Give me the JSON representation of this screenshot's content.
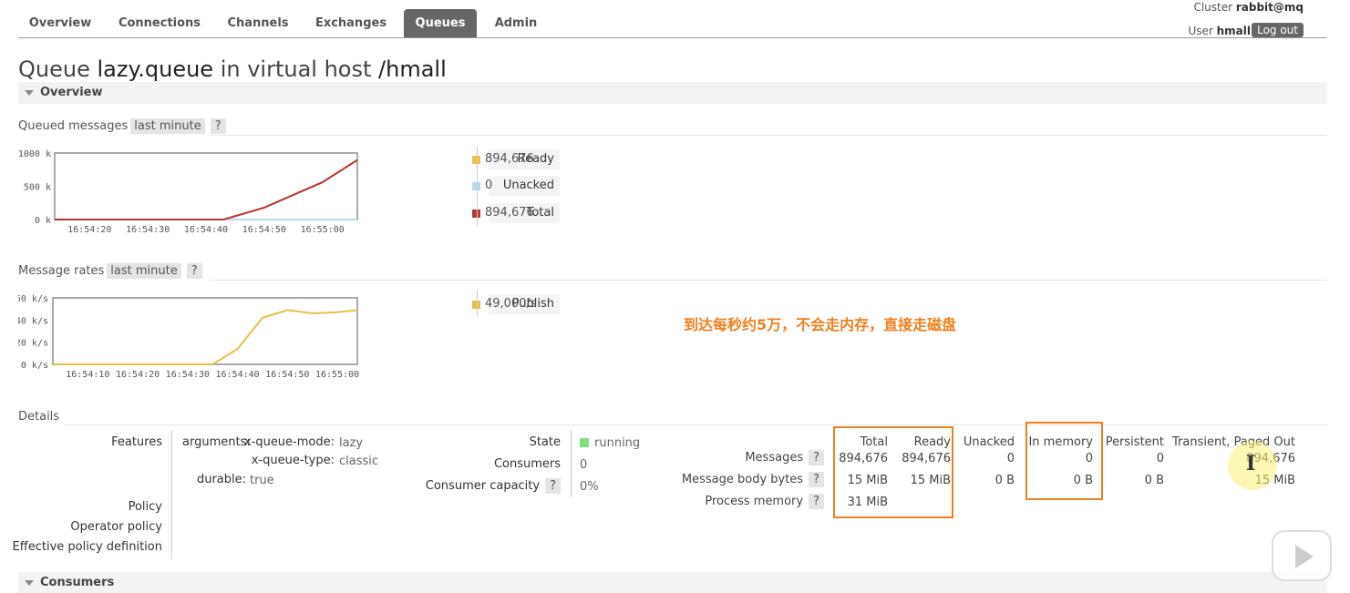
{
  "nav": {
    "tabs": [
      "Overview",
      "Connections",
      "Channels",
      "Exchanges",
      "Queues",
      "Admin"
    ],
    "active": "Queues",
    "cluster_label": "Cluster",
    "cluster_value": "rabbit@mq",
    "user_label": "User",
    "user_value": "hmall",
    "logout": "Log out"
  },
  "title": {
    "prefix": "Queue",
    "queue": "lazy.queue",
    "mid": "in virtual host",
    "vhost": "/hmall"
  },
  "overview": {
    "section_label": "Overview",
    "queued_label": "Queued messages",
    "queued_period": "last minute",
    "rates_label": "Message rates",
    "rates_period": "last minute",
    "help": "?",
    "queued_legend": [
      {
        "name": "Ready",
        "value": "894,676",
        "color": "#e8c048"
      },
      {
        "name": "Unacked",
        "value": "0",
        "color": "#b8d8f0"
      },
      {
        "name": "Total",
        "value": "894,676",
        "color": "#b83838"
      }
    ],
    "rates_legend": [
      {
        "name": "Publish",
        "value": "49,000/s",
        "color": "#e8c048"
      }
    ]
  },
  "chart_data": [
    {
      "type": "line",
      "y_ticks": [
        "1000 k",
        "500 k",
        "0 k"
      ],
      "x_ticks": [
        "16:54:20",
        "16:54:30",
        "16:54:40",
        "16:54:50",
        "16:55:00"
      ],
      "ylim": [
        0,
        1000000
      ],
      "x": [
        "16:54:14",
        "16:54:20",
        "16:54:30",
        "16:54:40",
        "16:54:43",
        "16:54:50",
        "16:55:00",
        "16:55:06"
      ],
      "series": [
        {
          "name": "Ready",
          "color": "#e8c048",
          "values": [
            0,
            0,
            0,
            0,
            0,
            180000,
            560000,
            894676
          ]
        },
        {
          "name": "Unacked",
          "color": "#b8d8f0",
          "values": [
            0,
            0,
            0,
            0,
            0,
            0,
            0,
            0
          ]
        },
        {
          "name": "Total",
          "color": "#b83838",
          "values": [
            0,
            0,
            0,
            0,
            0,
            180000,
            560000,
            894676
          ]
        }
      ]
    },
    {
      "type": "line",
      "y_ticks": [
        "60 k/s",
        "40 k/s",
        "20 k/s",
        "0 k/s"
      ],
      "x_ticks": [
        "16:54:10",
        "16:54:20",
        "16:54:30",
        "16:54:40",
        "16:54:50",
        "16:55:00"
      ],
      "ylim": [
        0,
        60000
      ],
      "x": [
        "16:54:03",
        "16:54:10",
        "16:54:20",
        "16:54:30",
        "16:54:35",
        "16:54:40",
        "16:54:45",
        "16:54:50",
        "16:54:55",
        "16:55:00",
        "16:55:04"
      ],
      "series": [
        {
          "name": "Publish",
          "color": "#e8c048",
          "values": [
            0,
            0,
            0,
            0,
            0,
            14000,
            42000,
            49000,
            46000,
            47000,
            49000
          ]
        }
      ]
    }
  ],
  "annotation": "到达每秒约5万，不会走内存，直接走磁盘",
  "details": {
    "label": "Details",
    "features_label": "Features",
    "arguments_label": "arguments:",
    "args": [
      {
        "key": "x-queue-mode:",
        "value": "lazy"
      },
      {
        "key": "x-queue-type:",
        "value": "classic"
      }
    ],
    "durable_label": "durable:",
    "durable_value": "true",
    "policy_label": "Policy",
    "operator_policy_label": "Operator policy",
    "effective_policy_label": "Effective policy definition",
    "state_label": "State",
    "state_value": "running",
    "consumers_label": "Consumers",
    "consumers_value": "0",
    "capacity_label": "Consumer capacity",
    "capacity_value": "0%",
    "stats_headers": [
      "Total",
      "Ready",
      "Unacked",
      "In memory",
      "Persistent",
      "Transient, Paged Out"
    ],
    "stats_rows": [
      {
        "label": "Messages",
        "values": [
          "894,676",
          "894,676",
          "0",
          "0",
          "0",
          "894,676"
        ]
      },
      {
        "label": "Message body bytes",
        "values": [
          "15 MiB",
          "15 MiB",
          "0 B",
          "0 B",
          "0 B",
          "15 MiB"
        ]
      },
      {
        "label": "Process memory",
        "values": [
          "31 MiB"
        ]
      }
    ]
  },
  "consumers_section": "Consumers"
}
